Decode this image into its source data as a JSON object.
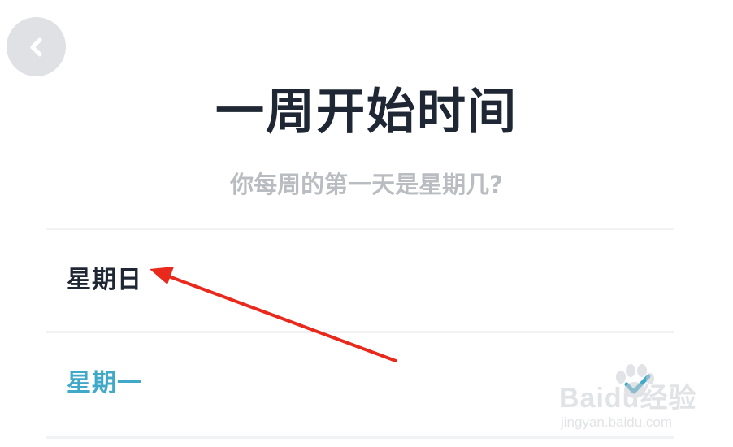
{
  "header": {
    "back_icon": "chevron-left-icon",
    "title": "一周开始时间",
    "subtitle": "你每周的第一天是星期几?"
  },
  "options": [
    {
      "label": "星期日",
      "selected": false
    },
    {
      "label": "星期一",
      "selected": true,
      "indicator_icon": "checkmark-icon"
    }
  ],
  "colors": {
    "title": "#1e2733",
    "subtitle": "#b9bcc1",
    "selected": "#41a9c8",
    "back_button_bg": "#dfe1e4",
    "annotation_arrow": "#e8291c"
  },
  "watermark": {
    "brand": "Baidu经验",
    "url": "jingyan.baidu.com"
  }
}
